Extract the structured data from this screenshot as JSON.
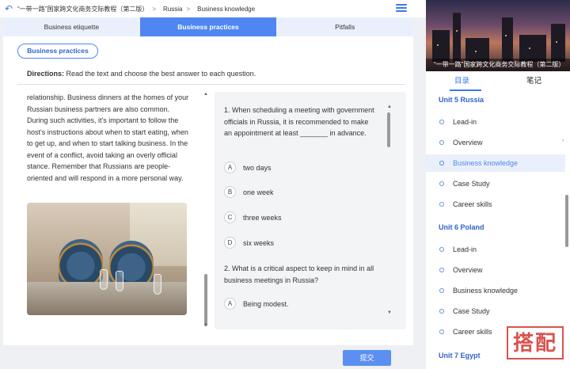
{
  "header": {
    "breadcrumbs": [
      "“一带一路”国家跨文化商务交际教程（第二版）",
      "Russia",
      "Business knowledge"
    ],
    "separator": ">"
  },
  "tabs": [
    {
      "label": "Business etiquette",
      "active": false
    },
    {
      "label": "Business practices",
      "active": true
    },
    {
      "label": "Pitfalls",
      "active": false
    }
  ],
  "main": {
    "section_pill": "Business practices",
    "directions_label": "Directions:",
    "directions_text": "Read the text and choose the best answer to each question.",
    "passage": "relationship. Business dinners at the homes of your Russian business partners are also common. During such activities, it's important to follow the host's instructions about when to start eating, when to get up, and when to start talking business. In the event of a conflict, avoid taking an overly official stance. Remember that Russians are people-oriented and will respond in a more personal way.",
    "questions": [
      {
        "text": "1. When scheduling a meeting with government officials in Russia, it is recommended to make an appointment at least _______ in advance.",
        "options": [
          {
            "letter": "A",
            "text": "two days"
          },
          {
            "letter": "B",
            "text": "one week"
          },
          {
            "letter": "C",
            "text": "three weeks"
          },
          {
            "letter": "D",
            "text": "six weeks"
          }
        ]
      },
      {
        "text": "2. What is a critical aspect to keep in mind in all business meetings in Russia?",
        "options": [
          {
            "letter": "A",
            "text": "Being modest."
          }
        ]
      }
    ],
    "submit_label": "提交"
  },
  "sidebar": {
    "book_title": "“一带一路”国家跨文化商务交际教程（第二版）",
    "tabs": [
      {
        "label": "目录",
        "active": true
      },
      {
        "label": "笔记",
        "active": false
      }
    ],
    "units": [
      {
        "title": "Unit 5 Russia",
        "items": [
          "Lead-in",
          "Overview",
          "Business knowledge",
          "Case Study",
          "Career skills"
        ]
      },
      {
        "title": "Unit 6 Poland",
        "items": [
          "Lead-in",
          "Overview",
          "Business knowledge",
          "Case Study",
          "Career skills"
        ]
      },
      {
        "title": "Unit 7 Egypt",
        "items": []
      }
    ],
    "active_item": "Business knowledge"
  },
  "watermark": "搭配",
  "colors": {
    "accent": "#4f86f1",
    "unit_title": "#2f62c8",
    "watermark": "#d9534f"
  }
}
